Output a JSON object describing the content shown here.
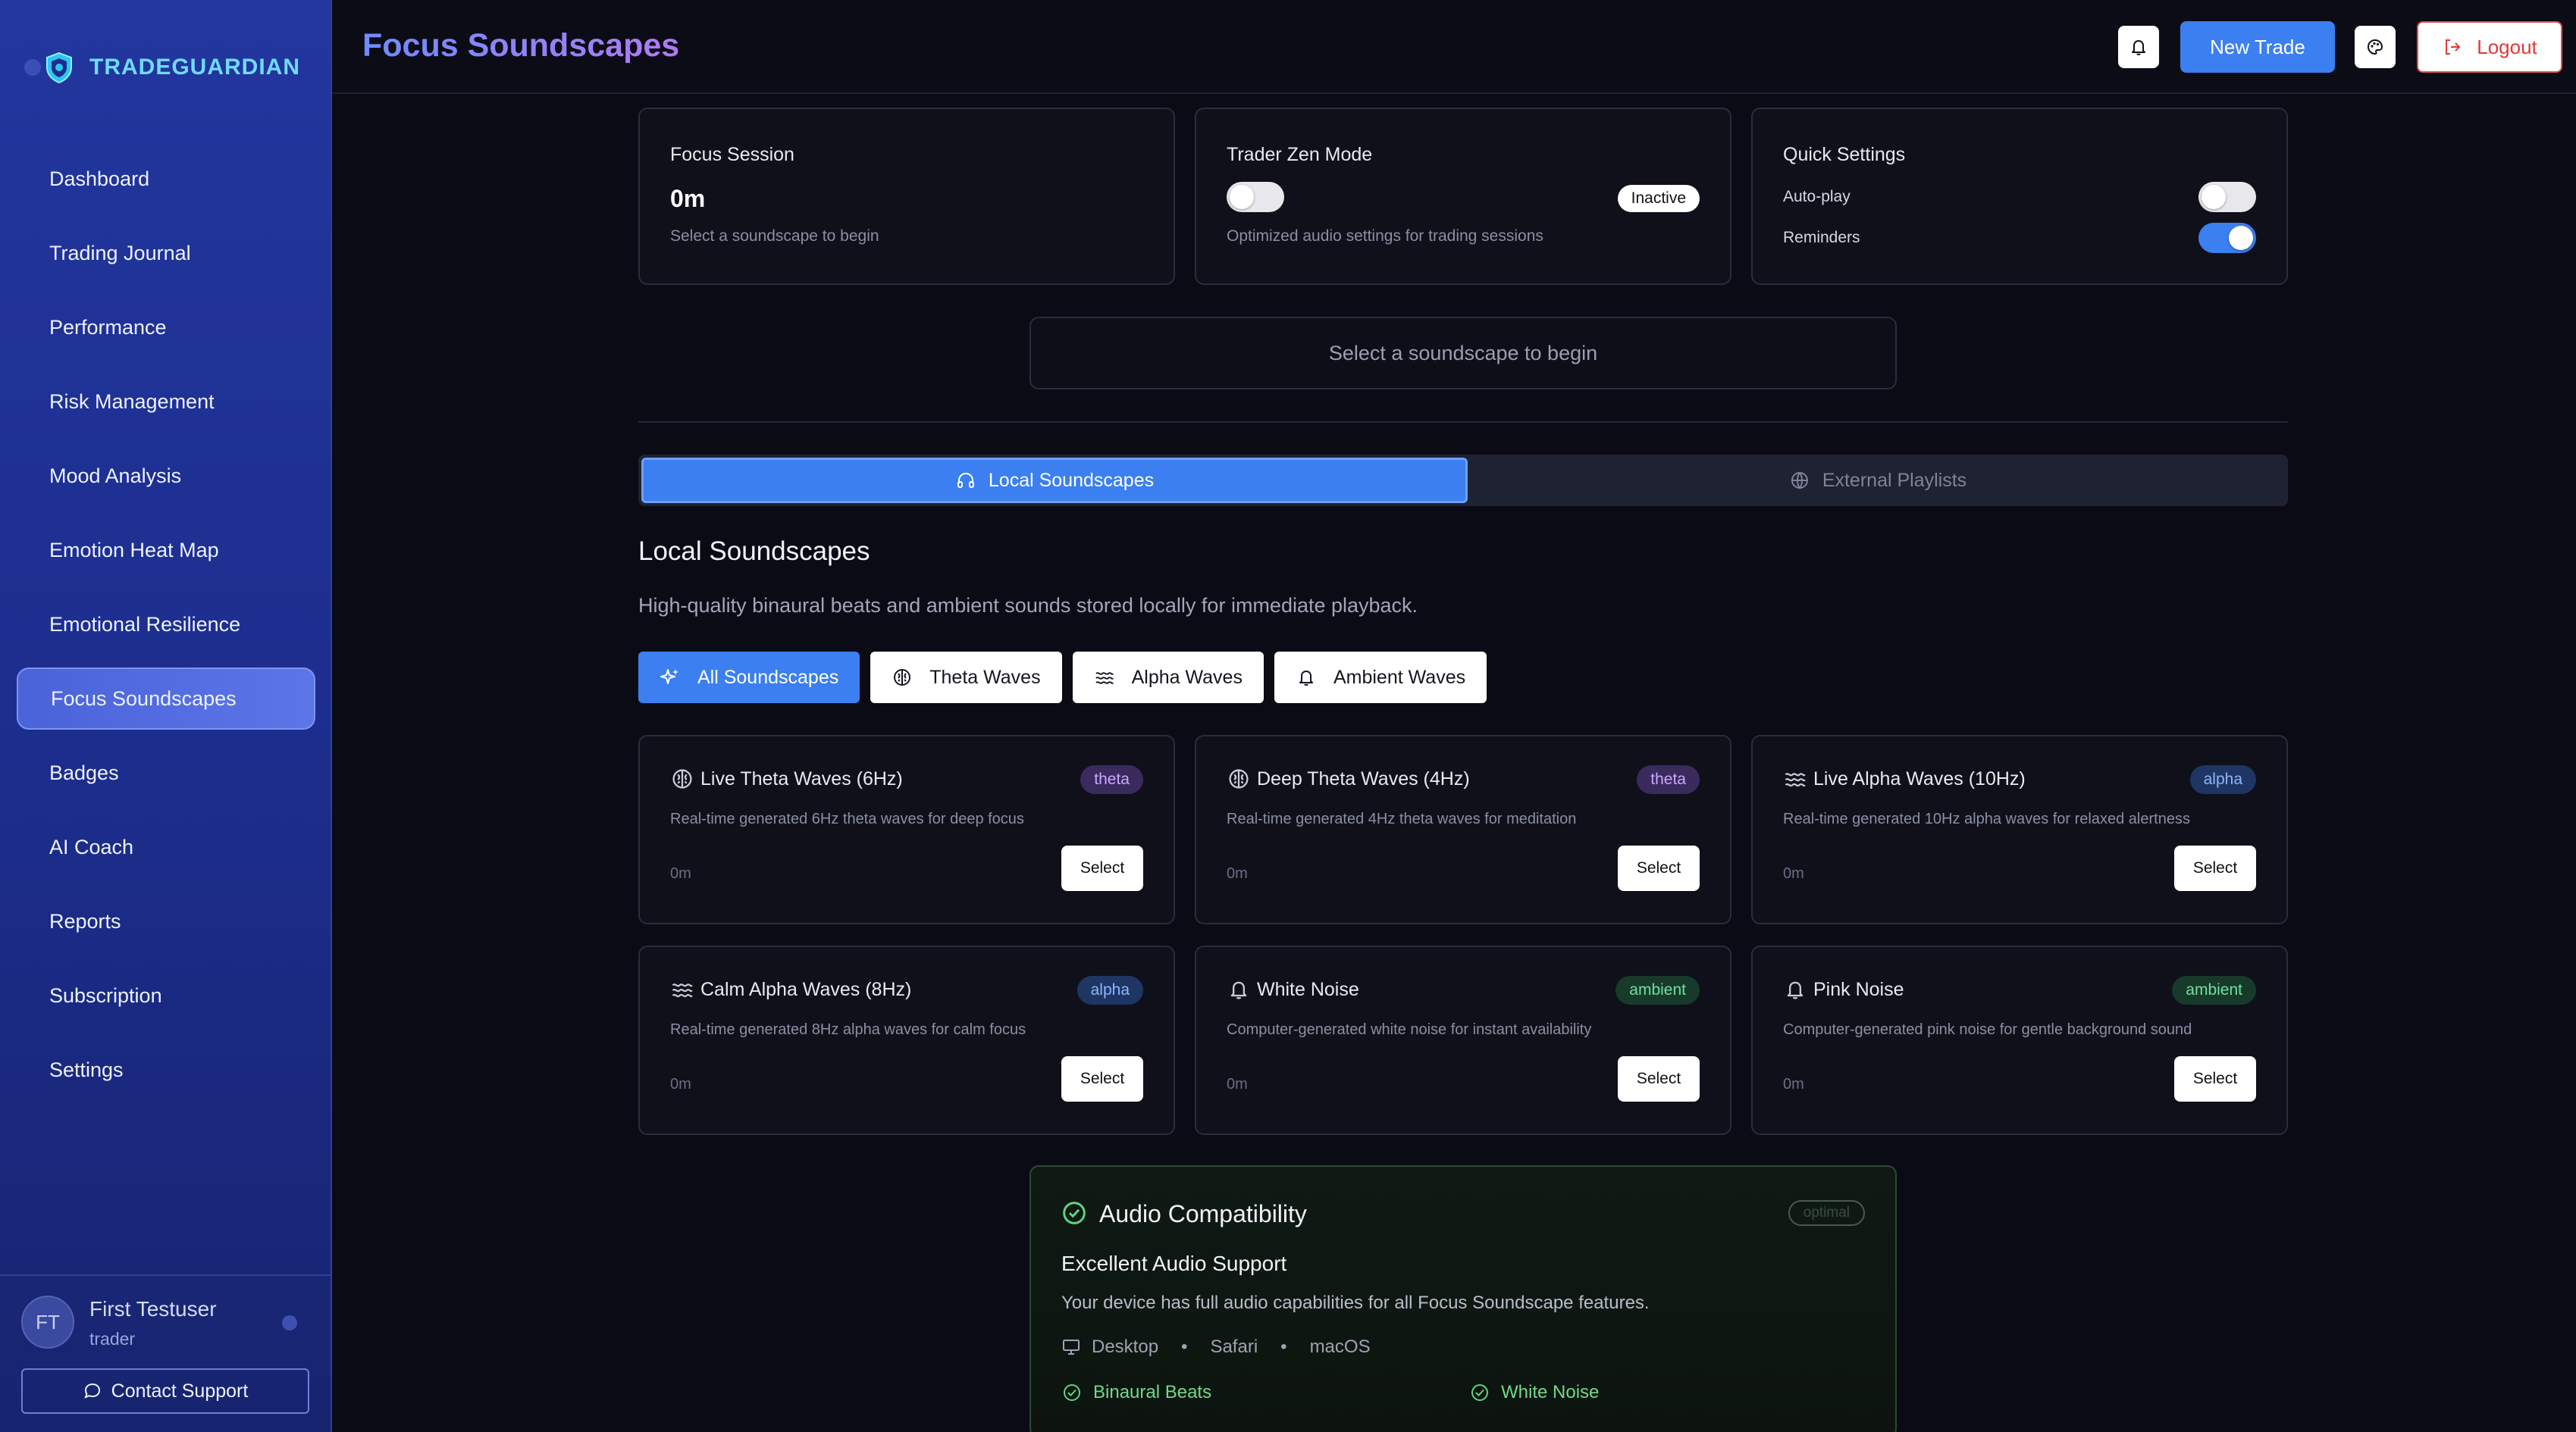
{
  "sidebar": {
    "brand": "TRADEGUARDIAN",
    "items": [
      {
        "label": "Dashboard"
      },
      {
        "label": "Trading Journal"
      },
      {
        "label": "Performance"
      },
      {
        "label": "Risk Management"
      },
      {
        "label": "Mood Analysis"
      },
      {
        "label": "Emotion Heat Map"
      },
      {
        "label": "Emotional Resilience"
      },
      {
        "label": "Focus Soundscapes",
        "active": true
      },
      {
        "label": "Badges"
      },
      {
        "label": "AI Coach"
      },
      {
        "label": "Reports"
      },
      {
        "label": "Subscription"
      },
      {
        "label": "Settings"
      }
    ],
    "user": {
      "initials": "FT",
      "name": "First Testuser",
      "role": "trader"
    },
    "contact_label": "Contact Support"
  },
  "header": {
    "title": "Focus Soundscapes",
    "new_trade_label": "New Trade",
    "logout_label": "Logout"
  },
  "focus_session": {
    "title": "Focus Session",
    "value": "0m",
    "subtitle": "Select a soundscape to begin"
  },
  "zen_mode": {
    "title": "Trader Zen Mode",
    "status": "Inactive",
    "subtitle": "Optimized audio settings for trading sessions",
    "enabled": false
  },
  "quick_settings": {
    "title": "Quick Settings",
    "autoplay_label": "Auto-play",
    "autoplay": false,
    "reminders_label": "Reminders",
    "reminders": true
  },
  "player": {
    "placeholder": "Select a soundscape to begin"
  },
  "tabs": {
    "local": "Local Soundscapes",
    "external": "External Playlists"
  },
  "local": {
    "heading": "Local Soundscapes",
    "description": "High-quality binaural beats and ambient sounds stored locally for immediate playback."
  },
  "filters": {
    "all": "All Soundscapes",
    "theta": "Theta Waves",
    "alpha": "Alpha Waves",
    "ambient": "Ambient Waves"
  },
  "soundscapes": [
    {
      "title": "Live Theta Waves (6Hz)",
      "badge": "theta",
      "description": "Real-time generated 6Hz theta waves for deep focus",
      "duration": "0m",
      "select": "Select"
    },
    {
      "title": "Deep Theta Waves (4Hz)",
      "badge": "theta",
      "description": "Real-time generated 4Hz theta waves for meditation",
      "duration": "0m",
      "select": "Select"
    },
    {
      "title": "Live Alpha Waves (10Hz)",
      "badge": "alpha",
      "description": "Real-time generated 10Hz alpha waves for relaxed alertness",
      "duration": "0m",
      "select": "Select"
    },
    {
      "title": "Calm Alpha Waves (8Hz)",
      "badge": "alpha",
      "description": "Real-time generated 8Hz alpha waves for calm focus",
      "duration": "0m",
      "select": "Select"
    },
    {
      "title": "White Noise",
      "badge": "ambient",
      "description": "Computer-generated white noise for instant availability",
      "duration": "0m",
      "select": "Select"
    },
    {
      "title": "Pink Noise",
      "badge": "ambient",
      "description": "Computer-generated pink noise for gentle background sound",
      "duration": "0m",
      "select": "Select"
    }
  ],
  "compat": {
    "title": "Audio Compatibility",
    "badge": "optimal",
    "subtitle": "Excellent Audio Support",
    "description": "Your device has full audio capabilities for all Focus Soundscape features.",
    "device": "Desktop",
    "browser": "Safari",
    "os": "macOS",
    "features": [
      "Binaural Beats",
      "White Noise"
    ]
  },
  "colors": {
    "accent": "#3b7ff0",
    "sidebar": "#22369e",
    "success": "#6fdb8a",
    "danger": "#e03a3a"
  }
}
